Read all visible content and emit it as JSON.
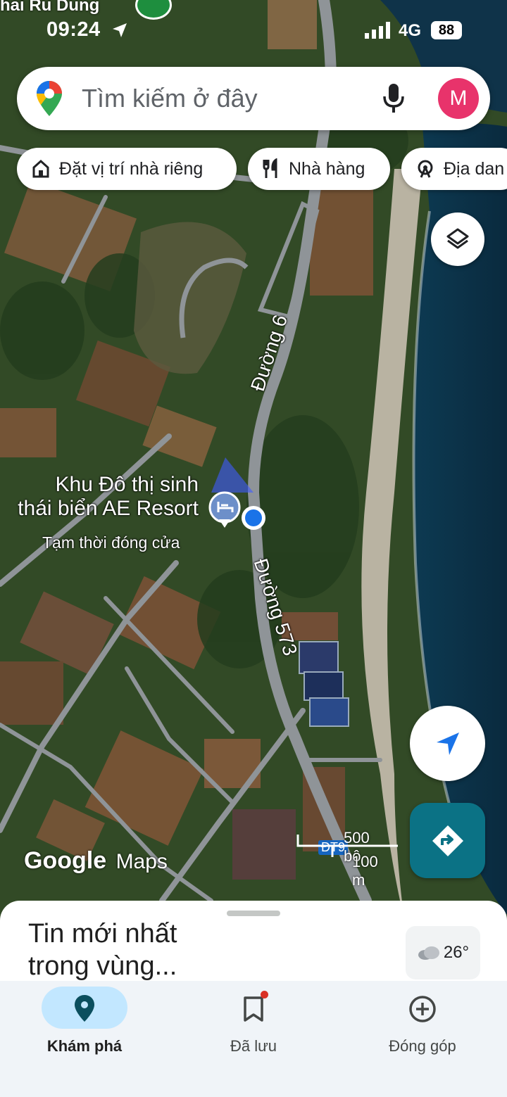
{
  "status_bar": {
    "time": "09:24",
    "network": "4G",
    "battery": "88"
  },
  "top_hint": "hai Ru Dung",
  "search": {
    "placeholder": "Tìm kiếm ở đây",
    "avatar_initial": "M"
  },
  "chips": [
    {
      "label": "Đặt vị trí nhà riêng",
      "icon": "home-icon"
    },
    {
      "label": "Nhà hàng",
      "icon": "restaurant-icon"
    },
    {
      "label": "Địa dan",
      "icon": "attractions-icon"
    }
  ],
  "map": {
    "road_labels": [
      "Đường 6",
      "Đường 573",
      "ĐT9"
    ],
    "poi": {
      "name_line1": "Khu Đô thị sinh",
      "name_line2": "thái biển AE Resort",
      "status": "Tạm thời đóng cửa",
      "icon": "hotel-icon"
    },
    "scale": {
      "imperial": "500 bộ",
      "metric": "100 m"
    },
    "attribution": {
      "google": "Google",
      "maps": "Maps"
    }
  },
  "sheet": {
    "title": "Tin mới nhất trong vùng...",
    "weather": "26°"
  },
  "bottom_nav": [
    {
      "label": "Khám phá",
      "icon": "explore-pin-icon",
      "active": true
    },
    {
      "label": "Đã lưu",
      "icon": "bookmark-icon",
      "active": false
    },
    {
      "label": "Đóng góp",
      "icon": "add-circle-icon",
      "active": false
    }
  ],
  "colors": {
    "accent": "#0b7285",
    "avatar": "#e8336b",
    "location_dot": "#1a73e8",
    "nav_active": "#c2e7ff"
  }
}
